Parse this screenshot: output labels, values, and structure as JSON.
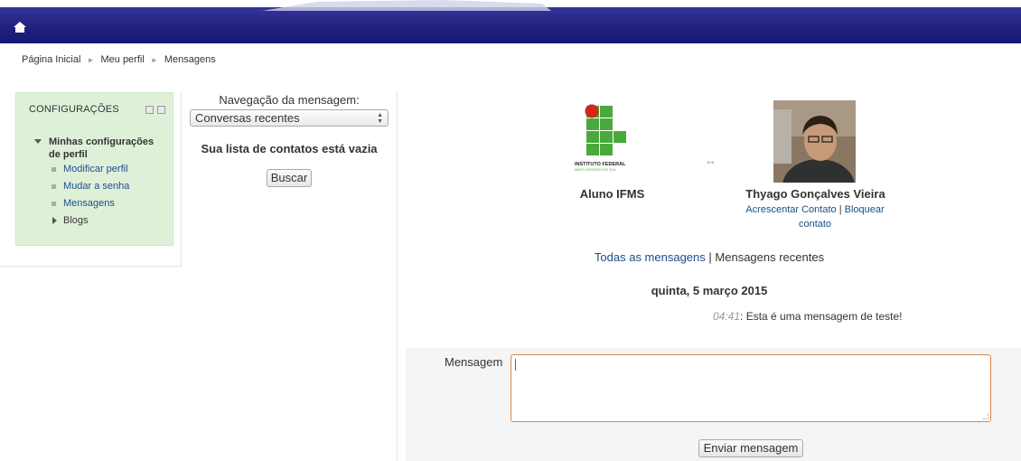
{
  "header": {
    "home_icon": "home-icon",
    "bar_color": "#1f1f7d"
  },
  "breadcrumb": {
    "items": [
      "Página Inicial",
      "Meu perfil",
      "Mensagens"
    ],
    "separator": "►"
  },
  "settings_block": {
    "title": "CONFIGURAÇÕES",
    "root_label": "Minhas configurações de perfil",
    "items": [
      {
        "label": "Modificar perfil"
      },
      {
        "label": "Mudar a senha"
      },
      {
        "label": "Mensagens"
      },
      {
        "label": "Blogs"
      }
    ]
  },
  "navigation": {
    "title": "Navegação da mensagem:",
    "select_value": "Conversas recentes",
    "empty_text": "Sua lista de contatos está vazia",
    "search_button": "Buscar"
  },
  "conversation": {
    "user_a": {
      "name": "Aluno IFMS",
      "logo_line1": "INSTITUTO FEDERAL",
      "logo_line2": "MATO GROSSO DO SUL"
    },
    "arrow": "↔",
    "user_b": {
      "name": "Thyago Gonçalves Vieira",
      "add_contact": "Acrescentar Contato",
      "separator": "|",
      "block_contact": "Bloquear contato"
    },
    "tabs": {
      "all": "Todas as mensagens",
      "separator": "|",
      "recent": "Mensagens recentes"
    },
    "day": "quinta, 5 março 2015",
    "messages": [
      {
        "time": "04:41",
        "text": ": Esta é uma mensagem de teste!"
      }
    ]
  },
  "form": {
    "label": "Mensagem",
    "send_button": "Enviar mensagem"
  }
}
